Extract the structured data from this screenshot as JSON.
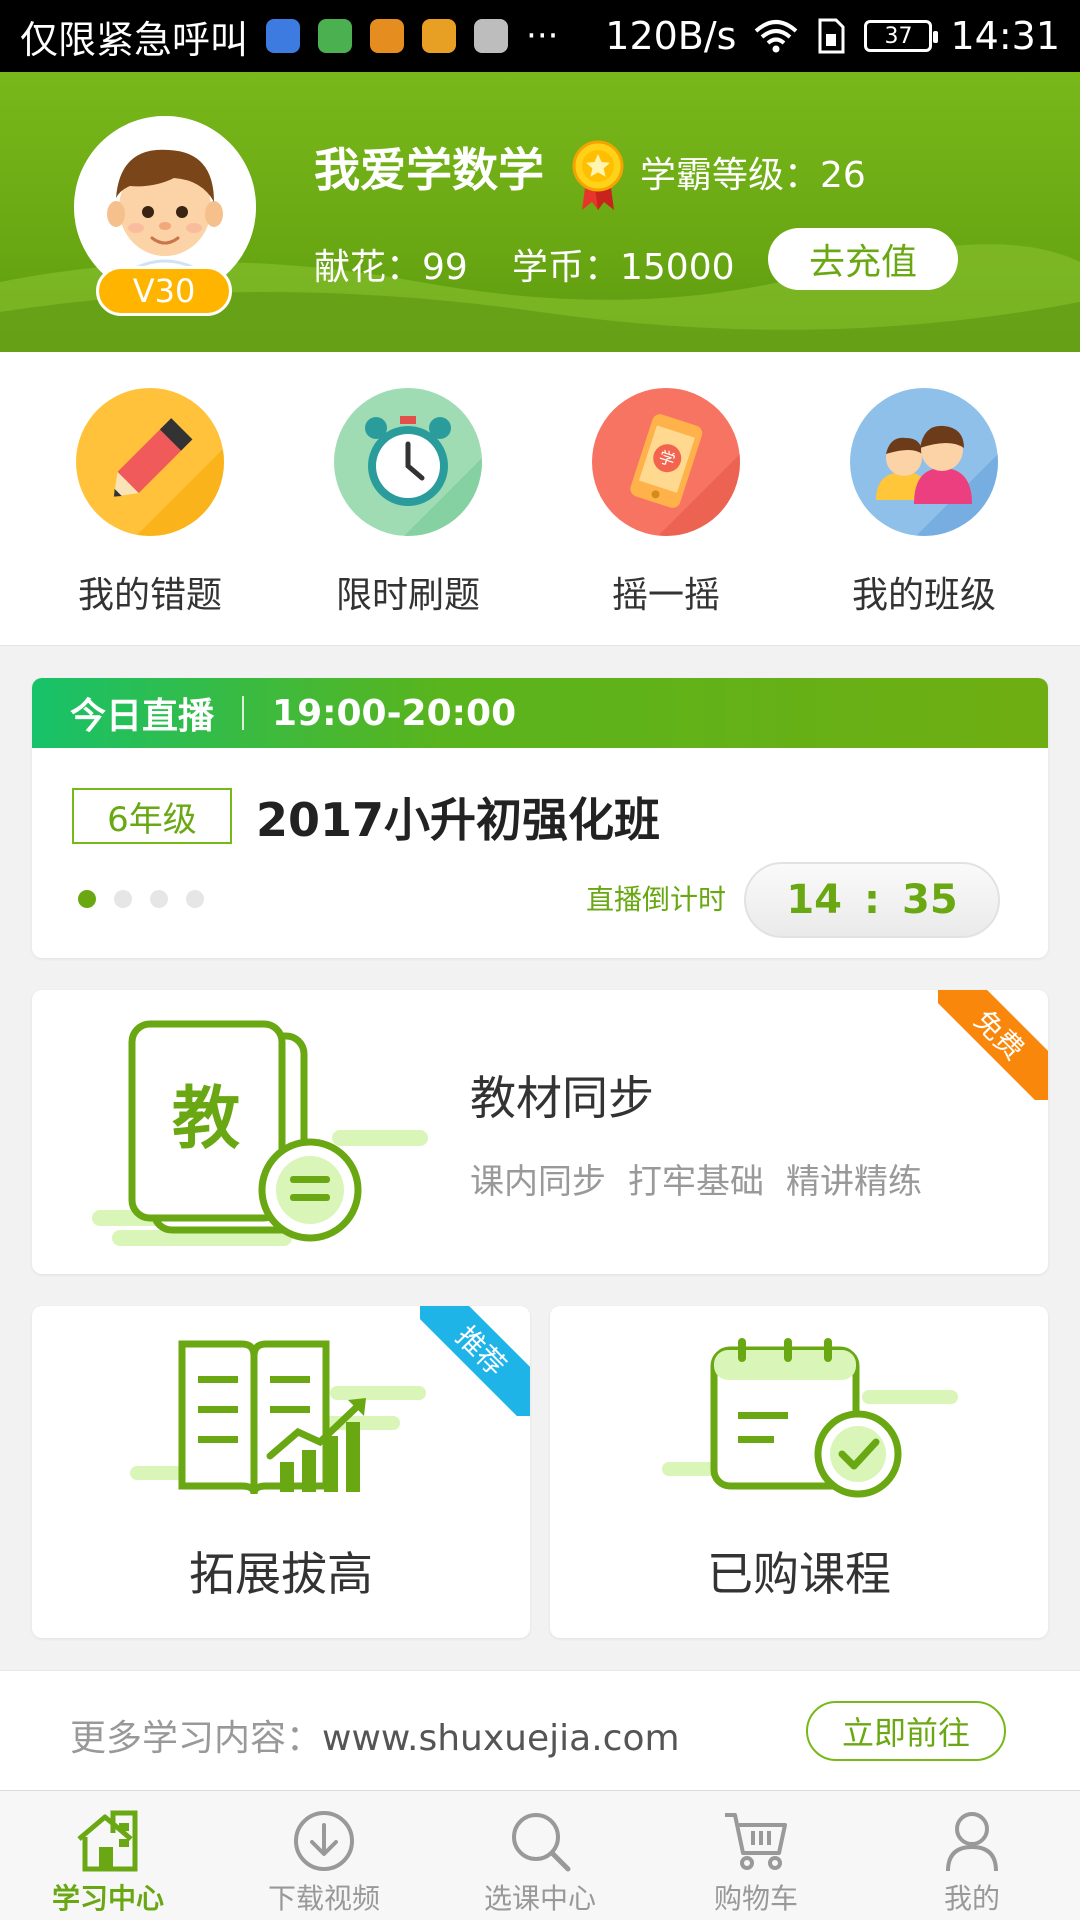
{
  "status_bar": {
    "carrier": "仅限紧急呼叫",
    "more": "···",
    "network_speed": "120B/s",
    "battery": "37",
    "time": "14:31"
  },
  "profile": {
    "username": "我爱学数学",
    "vip_level": "V30",
    "level_label": "学霸等级：26",
    "flowers_label": "献花：99",
    "coins_label": "学币：15000",
    "recharge_label": "去充值"
  },
  "quick_nav": [
    {
      "label": "我的错题",
      "icon": "pencil-icon",
      "color": "#ffb400"
    },
    {
      "label": "限时刷题",
      "icon": "alarm-clock-icon",
      "color": "#7fd19e"
    },
    {
      "label": "摇一摇",
      "icon": "phone-shake-icon",
      "color": "#f86b5a"
    },
    {
      "label": "我的班级",
      "icon": "classmates-icon",
      "color": "#7fb3e2"
    }
  ],
  "live": {
    "header_label": "今日直播",
    "time_range": "19:00-20:00",
    "grade_tag": "6年级",
    "course_title": "2017小升初强化班",
    "countdown_label": "直播倒计时",
    "countdown_minutes": "14",
    "countdown_sep": ":",
    "countdown_seconds": "35",
    "active_slide": 1,
    "slide_count": 4
  },
  "sync_card": {
    "icon_char": "教",
    "title": "教材同步",
    "tags": [
      "课内同步",
      "打牢基础",
      "精讲精练"
    ],
    "ribbon": "免费",
    "ribbon_color": "#f9870b"
  },
  "extend_card": {
    "label": "拓展拔高",
    "ribbon": "推荐",
    "ribbon_color": "#1fb4e8"
  },
  "purchased_card": {
    "label": "已购课程"
  },
  "more_content": {
    "label": "更多学习内容：",
    "url": "www.shuxuejia.com",
    "button": "立即前往"
  },
  "tabs": [
    {
      "label": "学习中心",
      "icon": "home-icon",
      "active": true
    },
    {
      "label": "下载视频",
      "icon": "download-icon",
      "active": false
    },
    {
      "label": "选课中心",
      "icon": "search-icon",
      "active": false
    },
    {
      "label": "购物车",
      "icon": "cart-icon",
      "active": false
    },
    {
      "label": "我的",
      "icon": "user-icon",
      "active": false
    }
  ],
  "colors": {
    "brand_green": "#6aa813",
    "light_green": "#d9f5b8",
    "vip_orange": "#ffb400"
  }
}
